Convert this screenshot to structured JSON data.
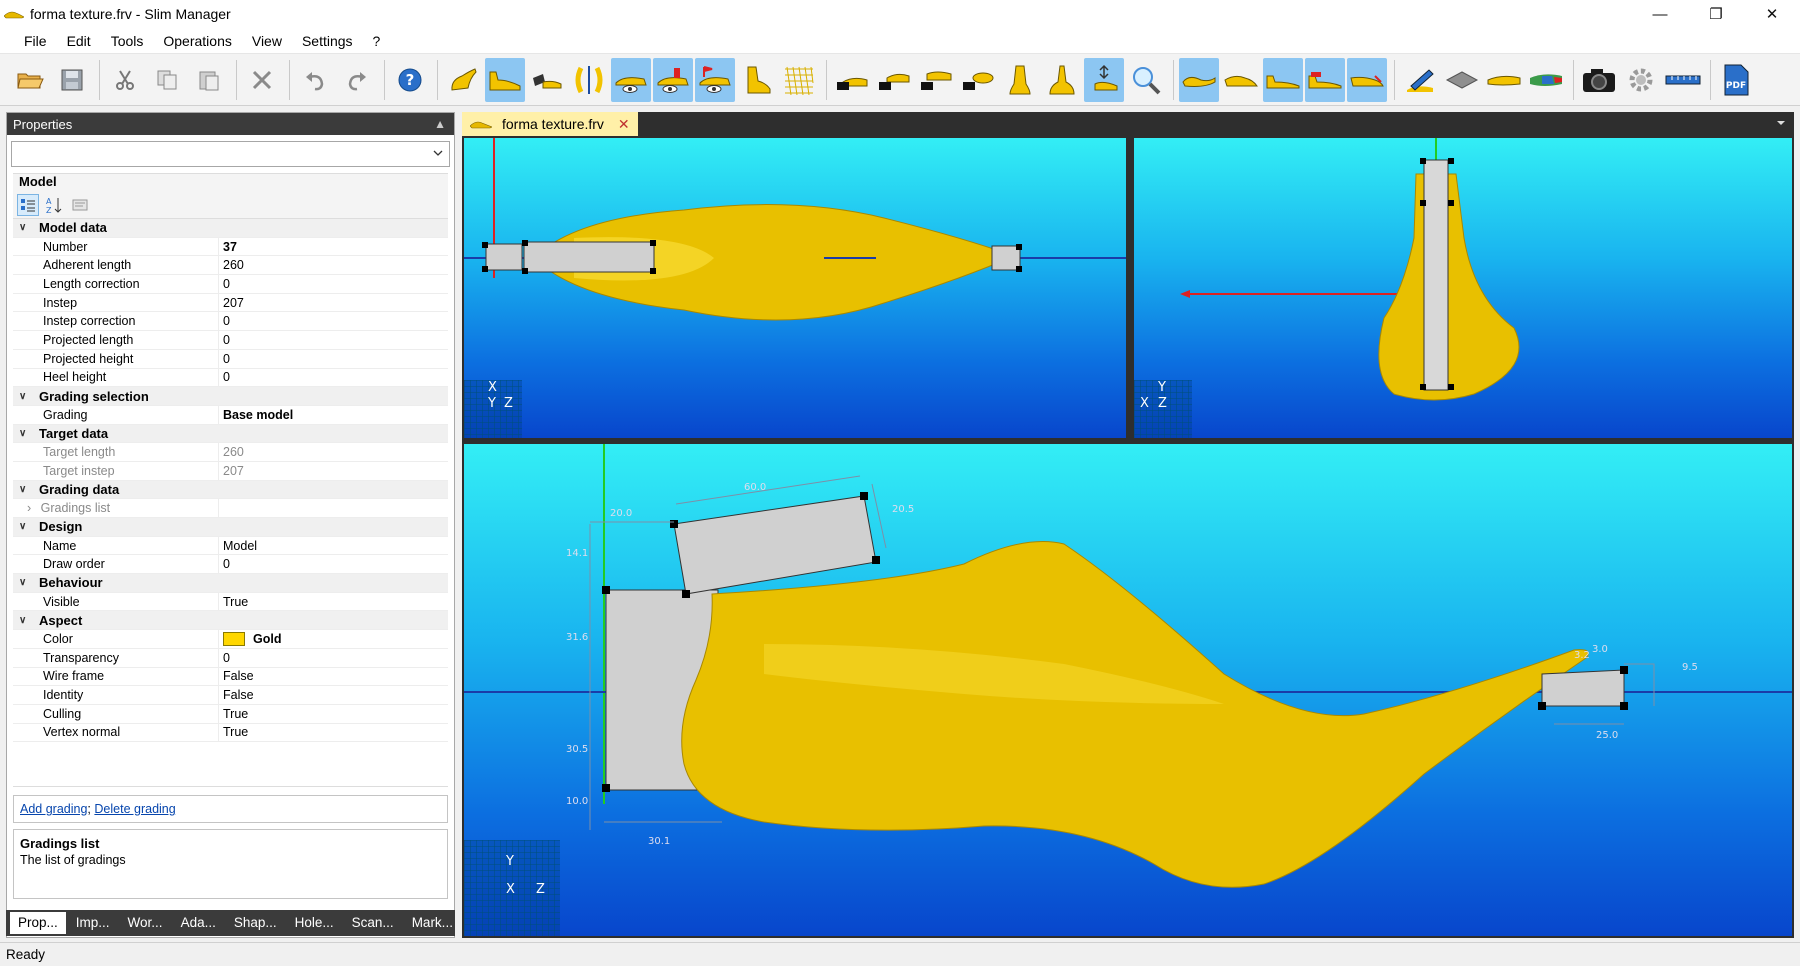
{
  "window": {
    "title": "forma texture.frv - Slim Manager"
  },
  "menu": [
    "File",
    "Edit",
    "Tools",
    "Operations",
    "View",
    "Settings",
    "?"
  ],
  "properties": {
    "header": "Properties",
    "object_title": "Model",
    "rows": [
      {
        "type": "cat",
        "label": "Model data"
      },
      {
        "type": "prop",
        "label": "Number",
        "value": "37",
        "bold": true
      },
      {
        "type": "prop",
        "label": "Adherent length",
        "value": "260"
      },
      {
        "type": "prop",
        "label": "Length correction",
        "value": "0"
      },
      {
        "type": "prop",
        "label": "Instep",
        "value": "207"
      },
      {
        "type": "prop",
        "label": "Instep correction",
        "value": "0"
      },
      {
        "type": "prop",
        "label": "Projected length",
        "value": "0"
      },
      {
        "type": "prop",
        "label": "Projected height",
        "value": "0"
      },
      {
        "type": "prop",
        "label": "Heel height",
        "value": "0"
      },
      {
        "type": "cat",
        "label": "Grading selection"
      },
      {
        "type": "prop",
        "label": "Grading",
        "value": "Base model",
        "bold": true
      },
      {
        "type": "cat",
        "label": "Target data"
      },
      {
        "type": "prop",
        "label": "Target length",
        "value": "260",
        "dim": true
      },
      {
        "type": "prop",
        "label": "Target instep",
        "value": "207",
        "dim": true
      },
      {
        "type": "cat",
        "label": "Grading data"
      },
      {
        "type": "sub",
        "label": "Gradings list",
        "value": ""
      },
      {
        "type": "cat",
        "label": "Design"
      },
      {
        "type": "prop",
        "label": "Name",
        "value": "Model"
      },
      {
        "type": "prop",
        "label": "Draw order",
        "value": "0"
      },
      {
        "type": "cat",
        "label": "Behaviour"
      },
      {
        "type": "prop",
        "label": "Visible",
        "value": "True"
      },
      {
        "type": "cat",
        "label": "Aspect"
      },
      {
        "type": "prop",
        "label": "Color",
        "value": "Gold",
        "bold": true,
        "swatch": "#ffd700"
      },
      {
        "type": "prop",
        "label": "Transparency",
        "value": "0"
      },
      {
        "type": "prop",
        "label": "Wire frame",
        "value": "False"
      },
      {
        "type": "prop",
        "label": "Identity",
        "value": "False"
      },
      {
        "type": "prop",
        "label": "Culling",
        "value": "True"
      },
      {
        "type": "prop",
        "label": "Vertex normal",
        "value": "True"
      }
    ],
    "links": {
      "add": "Add grading",
      "sep": ";",
      "delete": "Delete grading"
    },
    "description": {
      "title": "Gradings list",
      "text": "The list of gradings"
    }
  },
  "bottom_tabs": [
    "Prop...",
    "Imp...",
    "Wor...",
    "Ada...",
    "Shap...",
    "Hole...",
    "Scan...",
    "Mark..."
  ],
  "document_tab": "forma texture.frv",
  "viewports": {
    "top": {
      "axis_x": "X",
      "axis_y": "Y",
      "axis_z": "Z"
    },
    "front": {
      "axis_x": "X",
      "axis_y": "Y",
      "axis_z": "Z"
    },
    "side": {
      "axis_x": "X",
      "axis_y": "Y",
      "axis_z": "Z",
      "dims": {
        "d1": "60.0",
        "d2": "20.0",
        "d3": "20.5",
        "d4": "14.1",
        "d5": "31.6",
        "d6": "30.5",
        "d7": "10.0",
        "d8": "30.1",
        "d9": "3.2",
        "d10": "9.5",
        "d11": "25.0",
        "d12": "3.0"
      }
    }
  },
  "status": "Ready",
  "colors": {
    "last": "#ffd700",
    "accent": "#8cc6f2",
    "panel_header": "#3b3b3b"
  }
}
